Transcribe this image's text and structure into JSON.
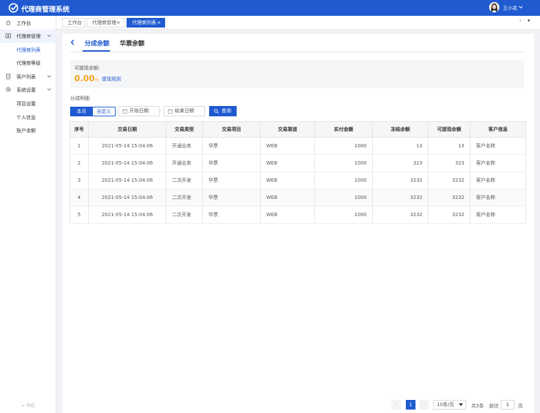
{
  "app": {
    "title": "代理商管理系统",
    "user_name": "王小花"
  },
  "sidebar": {
    "items": [
      {
        "label": "工作台"
      },
      {
        "label": "代理商管理"
      },
      {
        "label": "代理商列表"
      },
      {
        "label": "代理商等级"
      },
      {
        "label": "客户列表"
      },
      {
        "label": "系统设置"
      },
      {
        "label": "项目设置"
      },
      {
        "label": "个人信息"
      },
      {
        "label": "账户余额"
      }
    ],
    "collapse_label": "收起"
  },
  "tabs": [
    {
      "label": "工作台"
    },
    {
      "label": "代理商管理",
      "close": "×"
    },
    {
      "label": "代理商列表",
      "close": "×"
    }
  ],
  "tab_nav": {
    "next": "›",
    "menu": "▾"
  },
  "segment": {
    "tabs": [
      {
        "label": "分成余额"
      },
      {
        "label": "华票余额"
      }
    ]
  },
  "balance": {
    "label": "可提现余额:",
    "amount": "0.00",
    "unit": "元",
    "rule_link": "提现规则"
  },
  "detail": {
    "title": "分成明细",
    "btn_month": "本月",
    "btn_custom": "自定义",
    "start_placeholder": "开始日期",
    "sep": "-",
    "end_placeholder": "结束日期",
    "search_label": "查询"
  },
  "table": {
    "headers": [
      "序号",
      "交易日期",
      "交易类型",
      "交易项目",
      "交易渠道",
      "实付金额",
      "冻结余额",
      "可提现余额",
      "客户信息"
    ],
    "rows": [
      [
        "1",
        "2021-05-14 15:04:06",
        "开通业务",
        "华票",
        "WEB",
        "1000",
        "13",
        "13",
        "客户名称"
      ],
      [
        "2",
        "2021-05-14 15:04:06",
        "开通业务",
        "华票",
        "WEB",
        "1000",
        "323",
        "323",
        "客户名称"
      ],
      [
        "3",
        "2021-05-14 15:04:06",
        "二次开发",
        "华票",
        "WEB",
        "1000",
        "3232",
        "3232",
        "客户名称"
      ],
      [
        "4",
        "2021-05-14 15:04:06",
        "二次开发",
        "华票",
        "WEB",
        "1000",
        "3232",
        "3232",
        "客户名称"
      ],
      [
        "5",
        "2021-05-14 15:04:06",
        "二次开发",
        "华票",
        "WEB",
        "1000",
        "3232",
        "3232",
        "客户名称"
      ]
    ]
  },
  "pagination": {
    "prev": "‹",
    "current": "1",
    "next": "›",
    "page_size": "10条/页",
    "total": "共5条",
    "goto": "前往",
    "page_input": "1",
    "page_unit": "页"
  },
  "colors": {
    "primary": "#1f5ad1",
    "amount": "#f5a623"
  }
}
